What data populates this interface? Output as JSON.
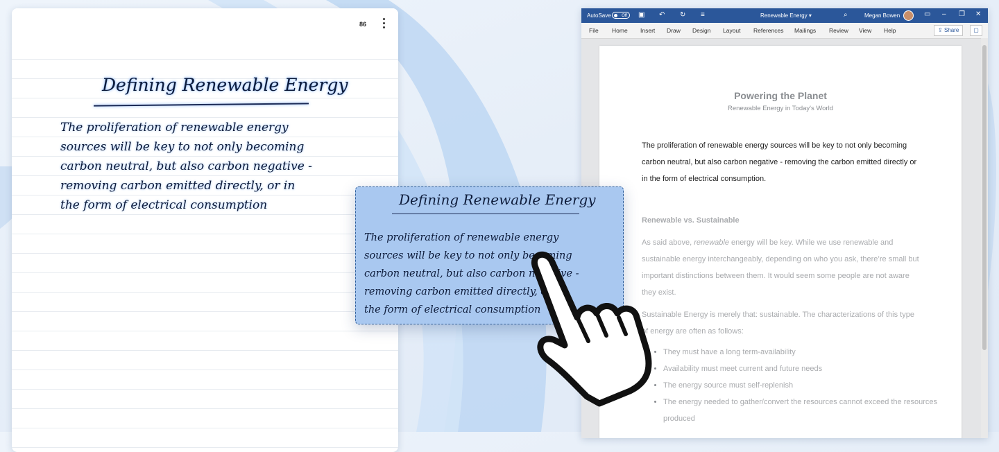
{
  "note": {
    "page_number": "86",
    "title": "Defining Renewable Energy",
    "lines": [
      "The proliferation of renewable energy",
      "sources will be key to not only becoming",
      "carbon neutral, but also carbon negative -",
      "removing carbon emitted directly, or in",
      "the form of electrical consumption"
    ]
  },
  "clipping": {
    "title": "Defining Renewable Energy",
    "lines": [
      "The proliferation of renewable energy",
      "sources will be key to not only becoming",
      "carbon neutral, but also carbon negative -",
      "removing carbon emitted directly, or in",
      "the form of electrical consumption"
    ]
  },
  "word": {
    "titlebar": {
      "autosave": "AutoSave",
      "toggle_state": "Off",
      "doc_name": "Renewable Energy ▾",
      "user_name": "Megan Bowen"
    },
    "menu": [
      "File",
      "Home",
      "Insert",
      "Draw",
      "Design",
      "Layout",
      "References",
      "Mailings",
      "Review",
      "View",
      "Help"
    ],
    "share_label": "Share",
    "document": {
      "title": "Powering the Planet",
      "subtitle": "Renewable Energy in Today's World",
      "intro": "The proliferation of renewable energy sources will be key to not only becoming carbon neutral, but also carbon negative - removing the carbon emitted directly or in the form of electrical consumption.",
      "heading": "Renewable vs. Sustainable",
      "para2_before": "As said above, ",
      "para2_em": "renewable",
      "para2_after": " energy will be key. While we use renewable and sustainable energy interchangeably, depending on who you ask, there’re small but important distinctions between them. It would seem some people are not aware they exist.",
      "para3": "Sustainable Energy is merely that: sustainable. The characterizations of this type of energy are often as follows:",
      "bullets": [
        "They must have a long term-availability",
        "Availability must meet current and future needs",
        "The energy source must self-replenish",
        "The energy needed to gather/convert the resources cannot exceed the resources produced"
      ]
    }
  },
  "colors": {
    "word_blue": "#2b579a",
    "clip_fill": "#a9c8f0",
    "ink": "#0d1b3a"
  }
}
